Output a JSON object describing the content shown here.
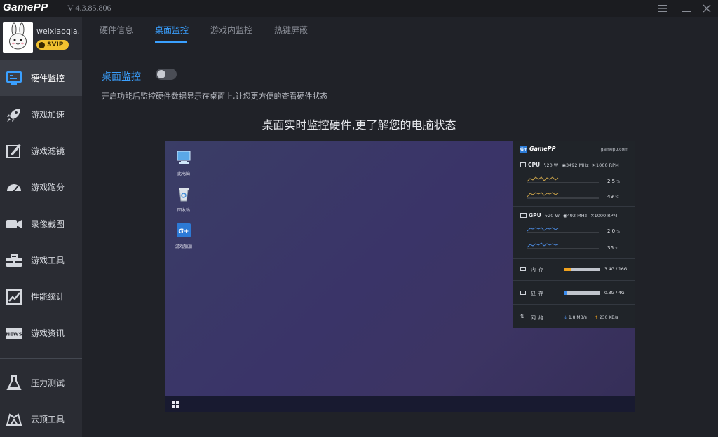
{
  "app": {
    "logo": "GamePP",
    "version": "V 4.3.85.806"
  },
  "user": {
    "name": "weixiaoqia..",
    "badge": "SVIP"
  },
  "sidebar": {
    "items": [
      {
        "label": "硬件监控",
        "icon": "hardware-monitor-icon",
        "active": true
      },
      {
        "label": "游戏加速",
        "icon": "rocket-icon"
      },
      {
        "label": "游戏滤镜",
        "icon": "filter-icon"
      },
      {
        "label": "游戏跑分",
        "icon": "speedometer-icon"
      },
      {
        "label": "录像截图",
        "icon": "video-camera-icon"
      },
      {
        "label": "游戏工具",
        "icon": "toolbox-icon"
      },
      {
        "label": "性能统计",
        "icon": "chart-icon"
      },
      {
        "label": "游戏资讯",
        "icon": "news-icon"
      },
      {
        "label": "压力测试",
        "icon": "flask-icon"
      },
      {
        "label": "云顶工具",
        "icon": "tft-icon"
      }
    ]
  },
  "tabs": [
    "硬件信息",
    "桌面监控",
    "游戏内监控",
    "热键屏蔽"
  ],
  "main": {
    "section_title": "桌面监控",
    "toggle_on": false,
    "description": "开启功能后监控硬件数据显示在桌面上,让您更方便的查看硬件状态",
    "heading": "桌面实时监控硬件,更了解您的电脑状态"
  },
  "preview": {
    "desktop_icons": [
      "此电脑",
      "回收站",
      "游戏加加"
    ],
    "overlay": {
      "logo": "GamePP",
      "logo_mark": "G+",
      "site": "gamepp.com",
      "cpu": {
        "label": "CPU",
        "power": "20 W",
        "clock": "3492 MHz",
        "fan": "1000 RPM",
        "usage": "2.5",
        "usage_unit": "%",
        "temp": "49",
        "temp_unit": "℃"
      },
      "gpu": {
        "label": "GPU",
        "power": "20 W",
        "clock": "492 MHz",
        "fan": "1000 RPM",
        "usage": "2.0",
        "usage_unit": "%",
        "temp": "36",
        "temp_unit": "℃"
      },
      "memory": {
        "label": "内存",
        "value": "3.4G / 16G",
        "fraction": 0.21,
        "color": "#f0a21e"
      },
      "vram": {
        "label": "显存",
        "value": "0.3G / 4G",
        "fraction": 0.075,
        "color": "#3a8df0"
      },
      "network": {
        "label": "网络",
        "down": "1.8 MB/s",
        "up": "230 KB/s"
      }
    }
  },
  "colors": {
    "accent": "#3aa0ff",
    "sidebar_bg": "#2a2c33",
    "active_bg": "#3a3d45"
  }
}
